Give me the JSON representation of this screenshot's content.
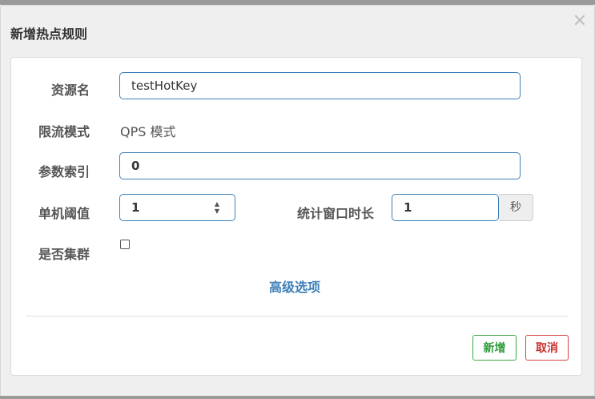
{
  "dialog": {
    "title": "新增热点规则",
    "close_glyph": "×"
  },
  "form": {
    "resource_name": {
      "label": "资源名",
      "value": "testHotKey"
    },
    "flow_mode": {
      "label": "限流模式",
      "value": "QPS 模式"
    },
    "param_index": {
      "label": "参数索引",
      "value": "0"
    },
    "threshold": {
      "label": "单机阈值",
      "value": "1"
    },
    "window": {
      "label": "统计窗口时长",
      "value": "1",
      "unit": "秒"
    },
    "cluster": {
      "label": "是否集群",
      "checked": false
    }
  },
  "advanced_link": "高级选项",
  "buttons": {
    "add": "新增",
    "cancel": "取消"
  },
  "colors": {
    "accent_blue": "#3f7fb6",
    "add_green": "#2e9b3b",
    "cancel_red": "#c9302c"
  },
  "icons": {
    "close": "close-icon",
    "spinner": "number-stepper-icon"
  }
}
